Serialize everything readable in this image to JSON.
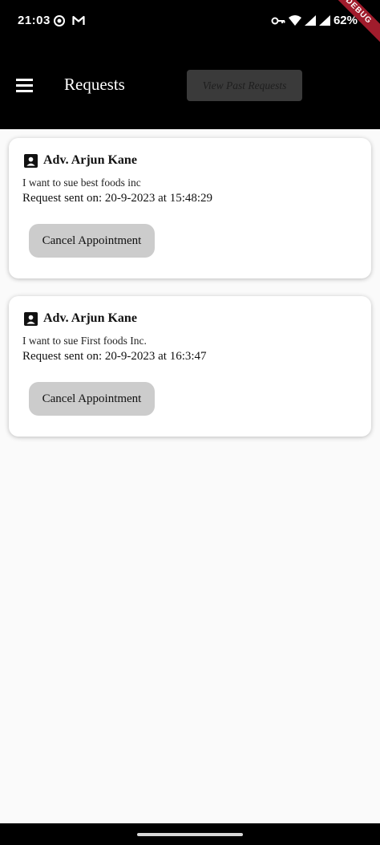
{
  "status_bar": {
    "time": "21:03",
    "right_text": "62%",
    "debug_label": "DEBUG"
  },
  "app_bar": {
    "title": "Requests",
    "view_past_label": "View Past Requests"
  },
  "requests": [
    {
      "lawyer": "Adv. Arjun Kane",
      "description": "I want to sue best foods inc",
      "sent_on": "Request sent on: 20-9-2023 at 15:48:29",
      "cancel_label": "Cancel Appointment"
    },
    {
      "lawyer": "Adv. Arjun Kane",
      "description": "I want to sue First foods Inc.",
      "sent_on": "Request sent on: 20-9-2023 at 16:3:47",
      "cancel_label": "Cancel Appointment"
    }
  ]
}
